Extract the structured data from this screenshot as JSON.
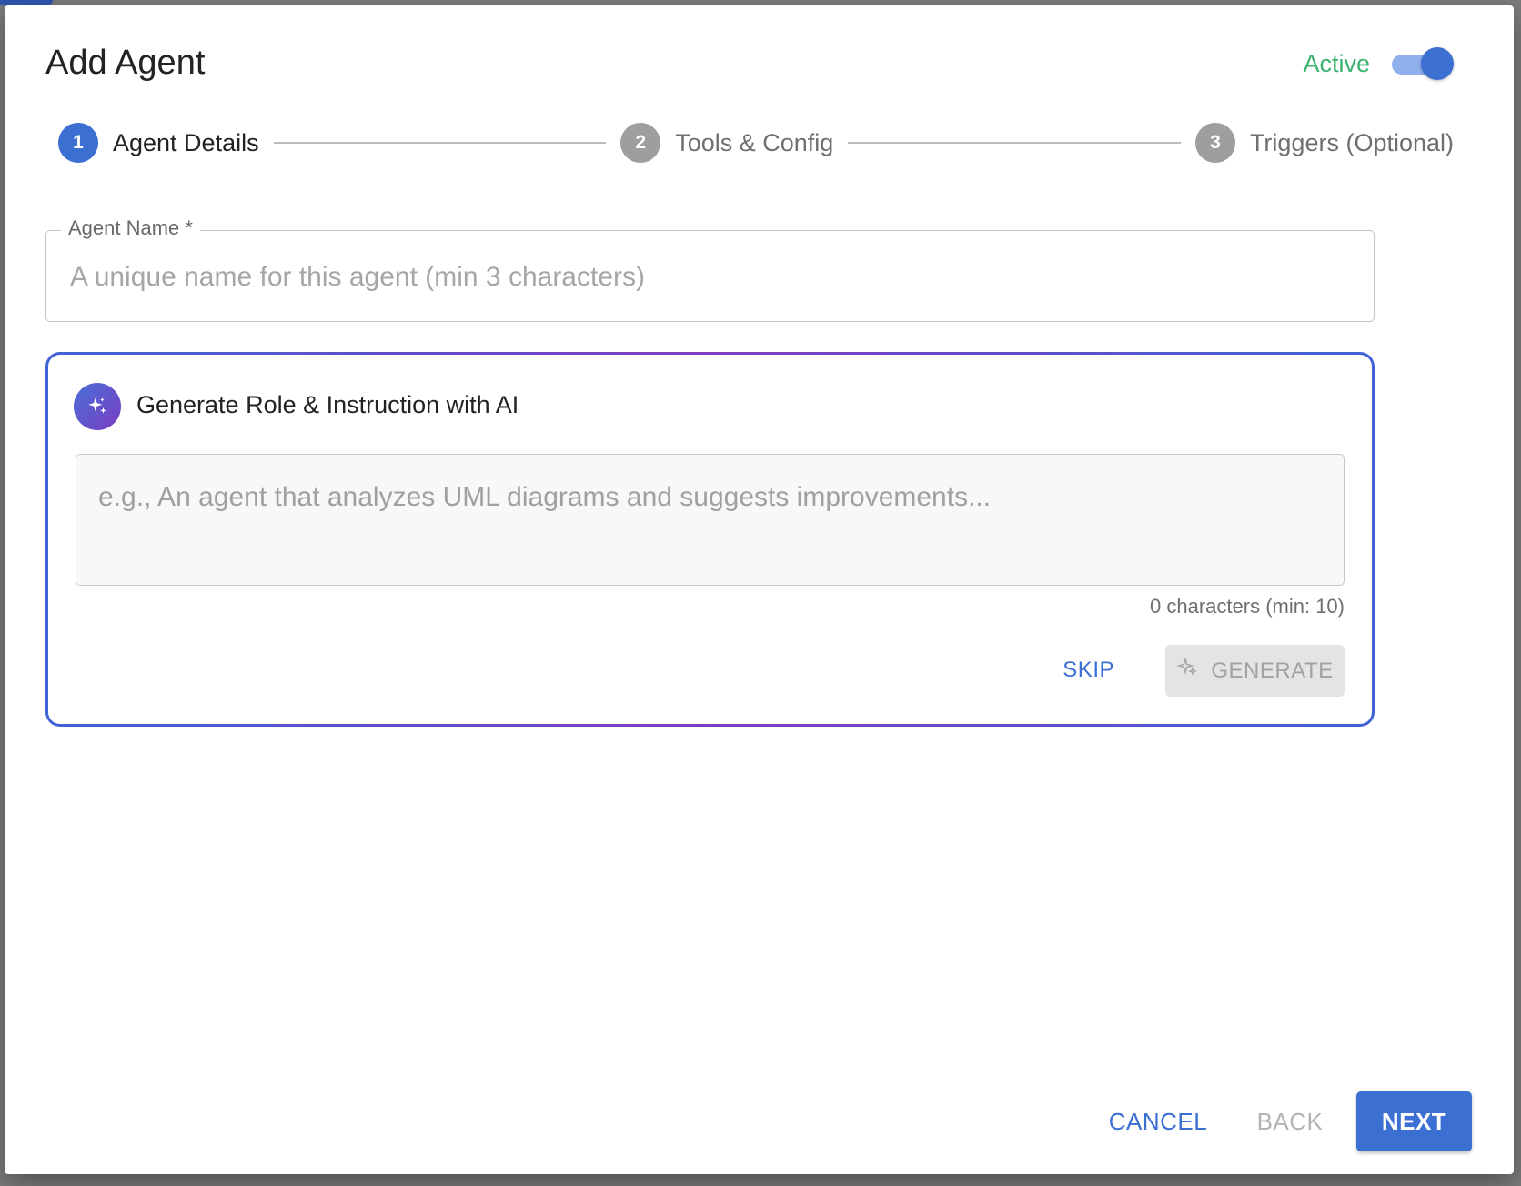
{
  "dialog": {
    "title": "Add Agent",
    "active_label": "Active",
    "active_on": true
  },
  "stepper": {
    "steps": [
      {
        "number": "1",
        "label": "Agent Details",
        "state": "active"
      },
      {
        "number": "2",
        "label": "Tools & Config",
        "state": "inactive"
      },
      {
        "number": "3",
        "label": "Triggers (Optional)",
        "state": "inactive"
      }
    ]
  },
  "agent_name": {
    "label": "Agent Name *",
    "value": "",
    "placeholder": "A unique name for this agent (min 3 characters)"
  },
  "ai_card": {
    "icon": "sparkle-icon",
    "title": "Generate Role & Instruction with AI",
    "value": "",
    "placeholder": "e.g., An agent that analyzes UML diagrams and suggests improvements...",
    "char_count": "0 characters (min: 10)",
    "skip_label": "SKIP",
    "generate_label": "GENERATE"
  },
  "footer": {
    "cancel_label": "CANCEL",
    "back_label": "BACK",
    "next_label": "NEXT"
  },
  "colors": {
    "primary": "#3b6fd2",
    "active_text": "#3cb371",
    "step_inactive": "#9e9e9e",
    "ai_gradient_start": "#3f63d6",
    "ai_gradient_mid": "#7e3cc0"
  }
}
